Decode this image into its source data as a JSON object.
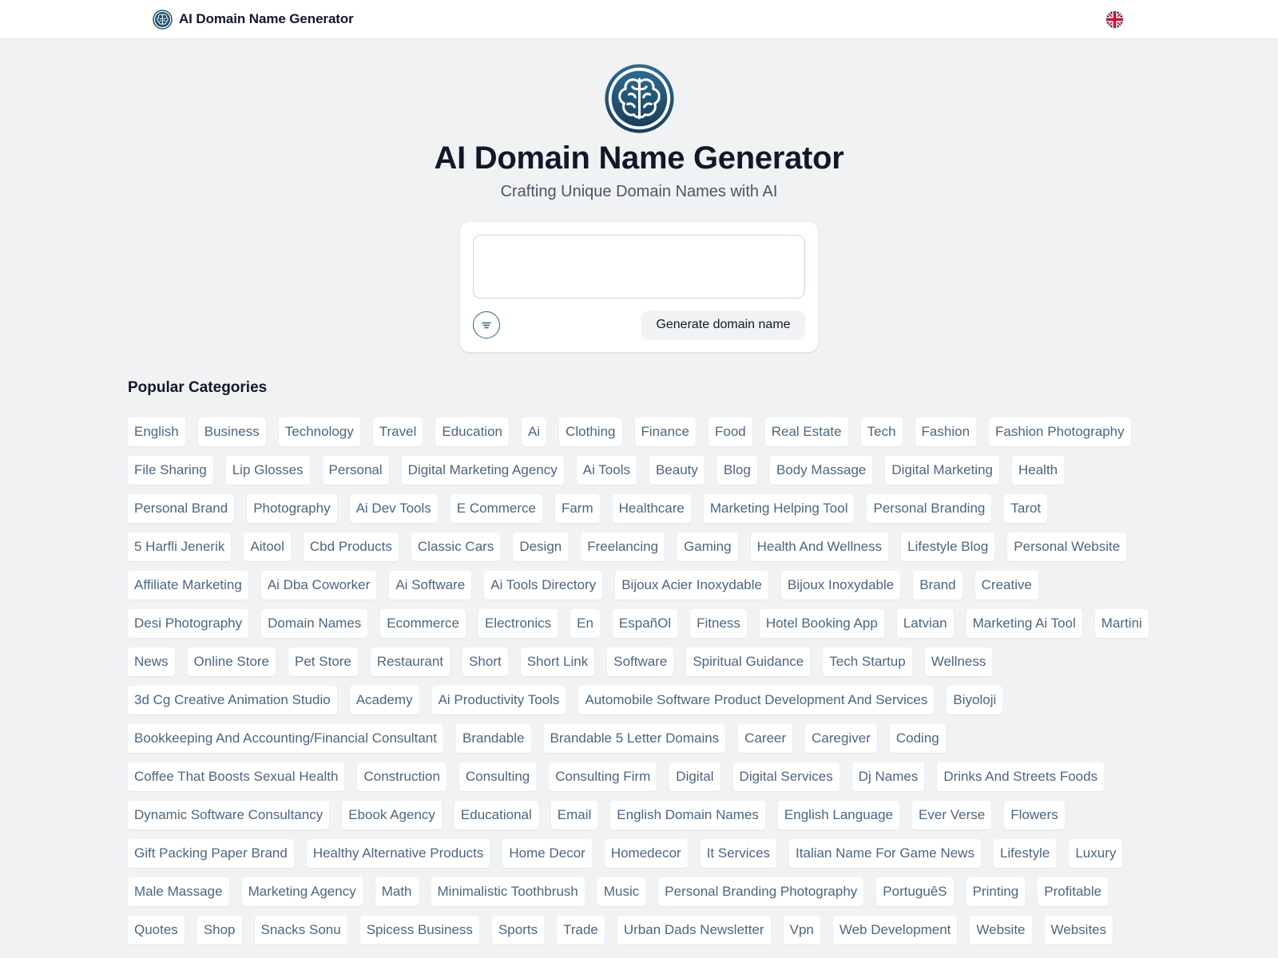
{
  "header": {
    "brand_name": "AI Domain Name Generator",
    "brand_icon": "brain-icon",
    "language_icon": "uk-flag-icon"
  },
  "hero": {
    "icon": "brain-icon",
    "title": "AI Domain Name Generator",
    "subtitle": "Crafting Unique Domain Names with AI"
  },
  "generator": {
    "input_value": "",
    "input_placeholder": "",
    "filter_icon": "filter-lines-icon",
    "button_label": "Generate domain name"
  },
  "categories": {
    "title": "Popular Categories",
    "items": [
      "English",
      "Business",
      "Technology",
      "Travel",
      "Education",
      "Ai",
      "Clothing",
      "Finance",
      "Food",
      "Real Estate",
      "Tech",
      "Fashion",
      "Fashion Photography",
      "File Sharing",
      "Lip Glosses",
      "Personal",
      "Digital Marketing Agency",
      "Ai Tools",
      "Beauty",
      "Blog",
      "Body Massage",
      "Digital Marketing",
      "Health",
      "Personal Brand",
      "Photography",
      "Ai Dev Tools",
      "E Commerce",
      "Farm",
      "Healthcare",
      "Marketing Helping Tool",
      "Personal Branding",
      "Tarot",
      "5 Harfli Jenerik",
      "Aitool",
      "Cbd Products",
      "Classic Cars",
      "Design",
      "Freelancing",
      "Gaming",
      "Health And Wellness",
      "Lifestyle Blog",
      "Personal Website",
      "Affiliate Marketing",
      "Ai Dba Coworker",
      "Ai Software",
      "Ai Tools Directory",
      "Bijoux Acier Inoxydable",
      "Bijoux Inoxydable",
      "Brand",
      "Creative",
      "Desi Photography",
      "Domain Names",
      "Ecommerce",
      "Electronics",
      "En",
      "EspañOl",
      "Fitness",
      "Hotel Booking App",
      "Latvian",
      "Marketing Ai Tool",
      "Martini",
      "News",
      "Online Store",
      "Pet Store",
      "Restaurant",
      "Short",
      "Short Link",
      "Software",
      "Spiritual Guidance",
      "Tech Startup",
      "Wellness",
      "3d Cg Creative Animation Studio",
      "Academy",
      "Ai Productivity Tools",
      "Automobile Software Product Development And Services",
      "Biyoloji",
      "Bookkeeping And Accounting/Financial Consultant",
      "Brandable",
      "Brandable 5 Letter Domains",
      "Career",
      "Caregiver",
      "Coding",
      "Coffee That Boosts Sexual Health",
      "Construction",
      "Consulting",
      "Consulting Firm",
      "Digital",
      "Digital Services",
      "Dj Names",
      "Drinks And Streets Foods",
      "Dynamic Software Consultancy",
      "Ebook Agency",
      "Educational",
      "Email",
      "English Domain Names",
      "English Language",
      "Ever Verse",
      "Flowers",
      "Gift Packing Paper Brand",
      "Healthy Alternative Products",
      "Home Decor",
      "Homedecor",
      "It Services",
      "Italian Name For Game News",
      "Lifestyle",
      "Luxury",
      "Male Massage",
      "Marketing Agency",
      "Math",
      "Minimalistic Toothbrush",
      "Music",
      "Personal Branding Photography",
      "PortuguêS",
      "Printing",
      "Profitable",
      "Quotes",
      "Shop",
      "Snacks Sonu",
      "Spicess Business",
      "Sports",
      "Trade",
      "Urban Dads Newsletter",
      "Vpn",
      "Web Development",
      "Website",
      "Websites"
    ]
  }
}
